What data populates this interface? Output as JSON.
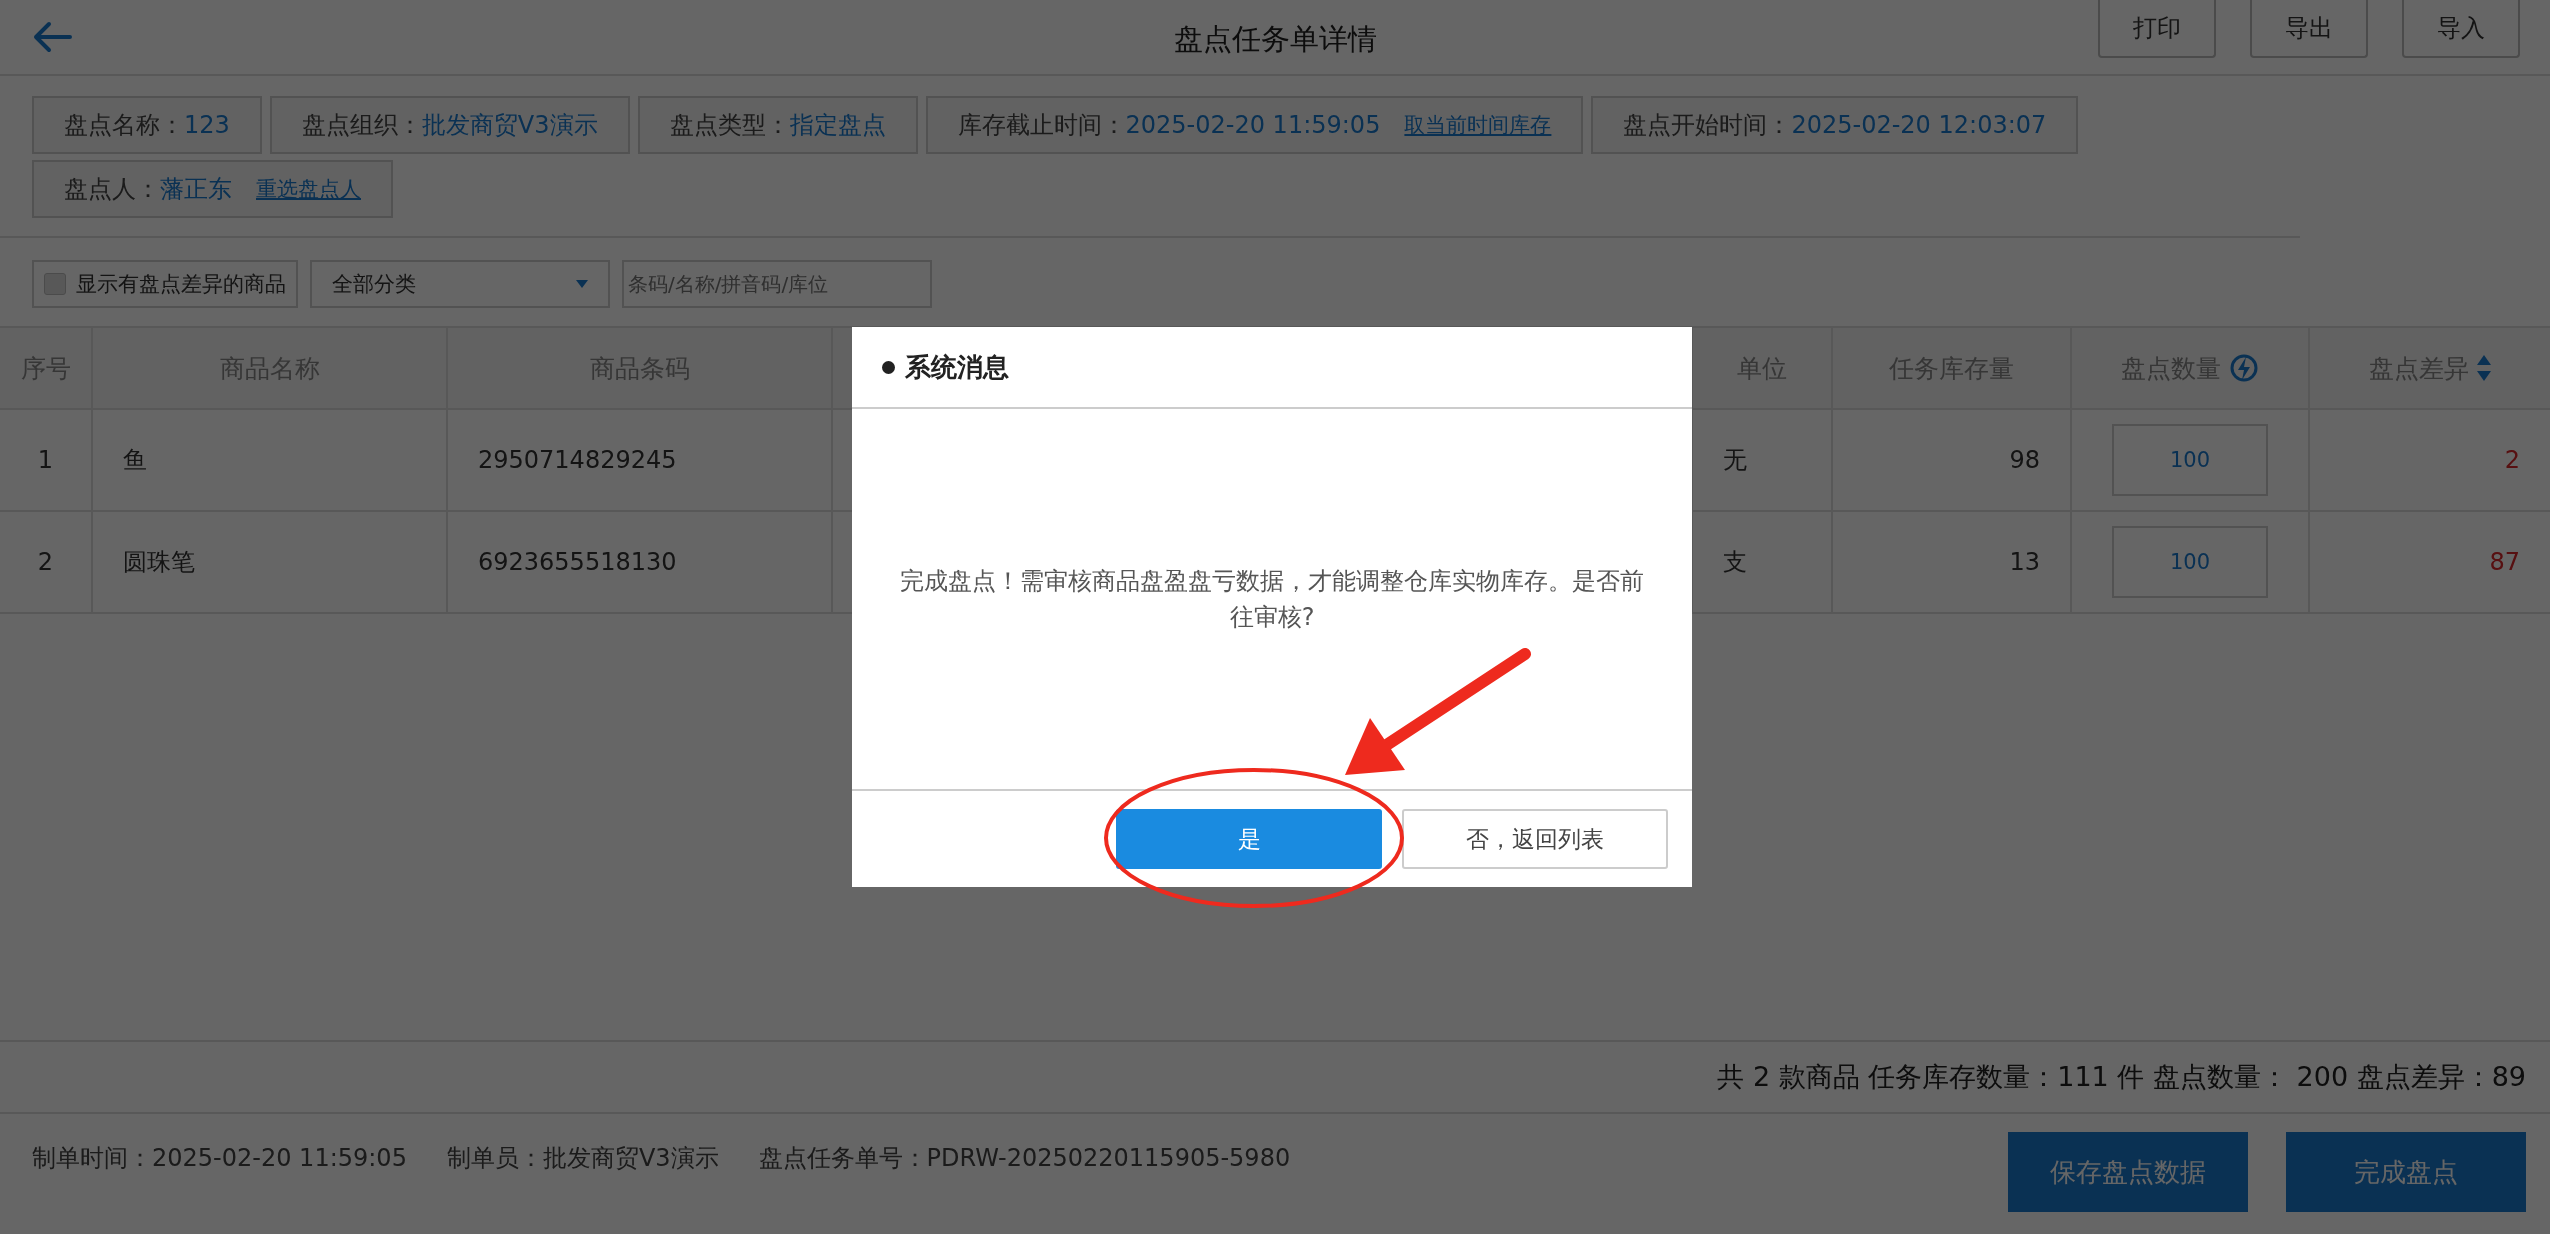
{
  "header": {
    "title": "盘点任务单详情",
    "buttons": [
      "打印",
      "导出",
      "导入"
    ]
  },
  "info_fields": [
    {
      "label": "盘点名称：",
      "value": "123"
    },
    {
      "label": "盘点组织：",
      "value": "批发商贸V3演示"
    },
    {
      "label": "盘点类型：",
      "value": "指定盘点"
    },
    {
      "label": "库存截止时间：",
      "value": "2025-02-20 11:59:05",
      "link": "取当前时间库存"
    },
    {
      "label": "盘点开始时间：",
      "value": "2025-02-20 12:03:07"
    },
    {
      "label": "盘点人：",
      "value": "藩正东",
      "link": "重选盘点人"
    }
  ],
  "filters": {
    "diff_only": {
      "label": "显示有盘点差异的商品",
      "checked": false
    },
    "category": {
      "value": "全部分类"
    },
    "search": {
      "placeholder": "条码/名称/拼音码/库位"
    }
  },
  "table": {
    "columns": [
      {
        "label": "序号",
        "kind": "plain"
      },
      {
        "label": "商品名称",
        "kind": "plain"
      },
      {
        "label": "商品条码",
        "kind": "plain"
      },
      {
        "label": "单位",
        "kind": "plain"
      },
      {
        "label": "任务库存量",
        "kind": "plain"
      },
      {
        "label": "盘点数量",
        "kind": "quickfill"
      },
      {
        "label": "盘点差异",
        "kind": "sortable"
      }
    ],
    "rows": [
      {
        "index": "1",
        "name": "鱼",
        "barcode": "2950714829245",
        "unit": "无",
        "stock": "98",
        "count": "100",
        "diff": "2"
      },
      {
        "index": "2",
        "name": "圆珠笔",
        "barcode": "6923655518130",
        "unit": "支",
        "stock": "13",
        "count": "100",
        "diff": "87"
      }
    ]
  },
  "summary": "共 2 款商品 任务库存数量：111 件 盘点数量： 200 盘点差异：89",
  "meta": [
    "制单时间：2025-02-20 11:59:05",
    "制单员：批发商贸V3演示",
    "盘点任务单号：PDRW-20250220115905-5980"
  ],
  "actions": [
    "保存盘点数据",
    "完成盘点"
  ],
  "dialog": {
    "title": "系统消息",
    "message": "完成盘点！需审核商品盘盈盘亏数据，才能调整仓库实物库存。是否前往审核?",
    "buttons": [
      {
        "label": "是",
        "kind": "primary"
      },
      {
        "label": "否，返回列表",
        "kind": "secondary"
      }
    ]
  }
}
